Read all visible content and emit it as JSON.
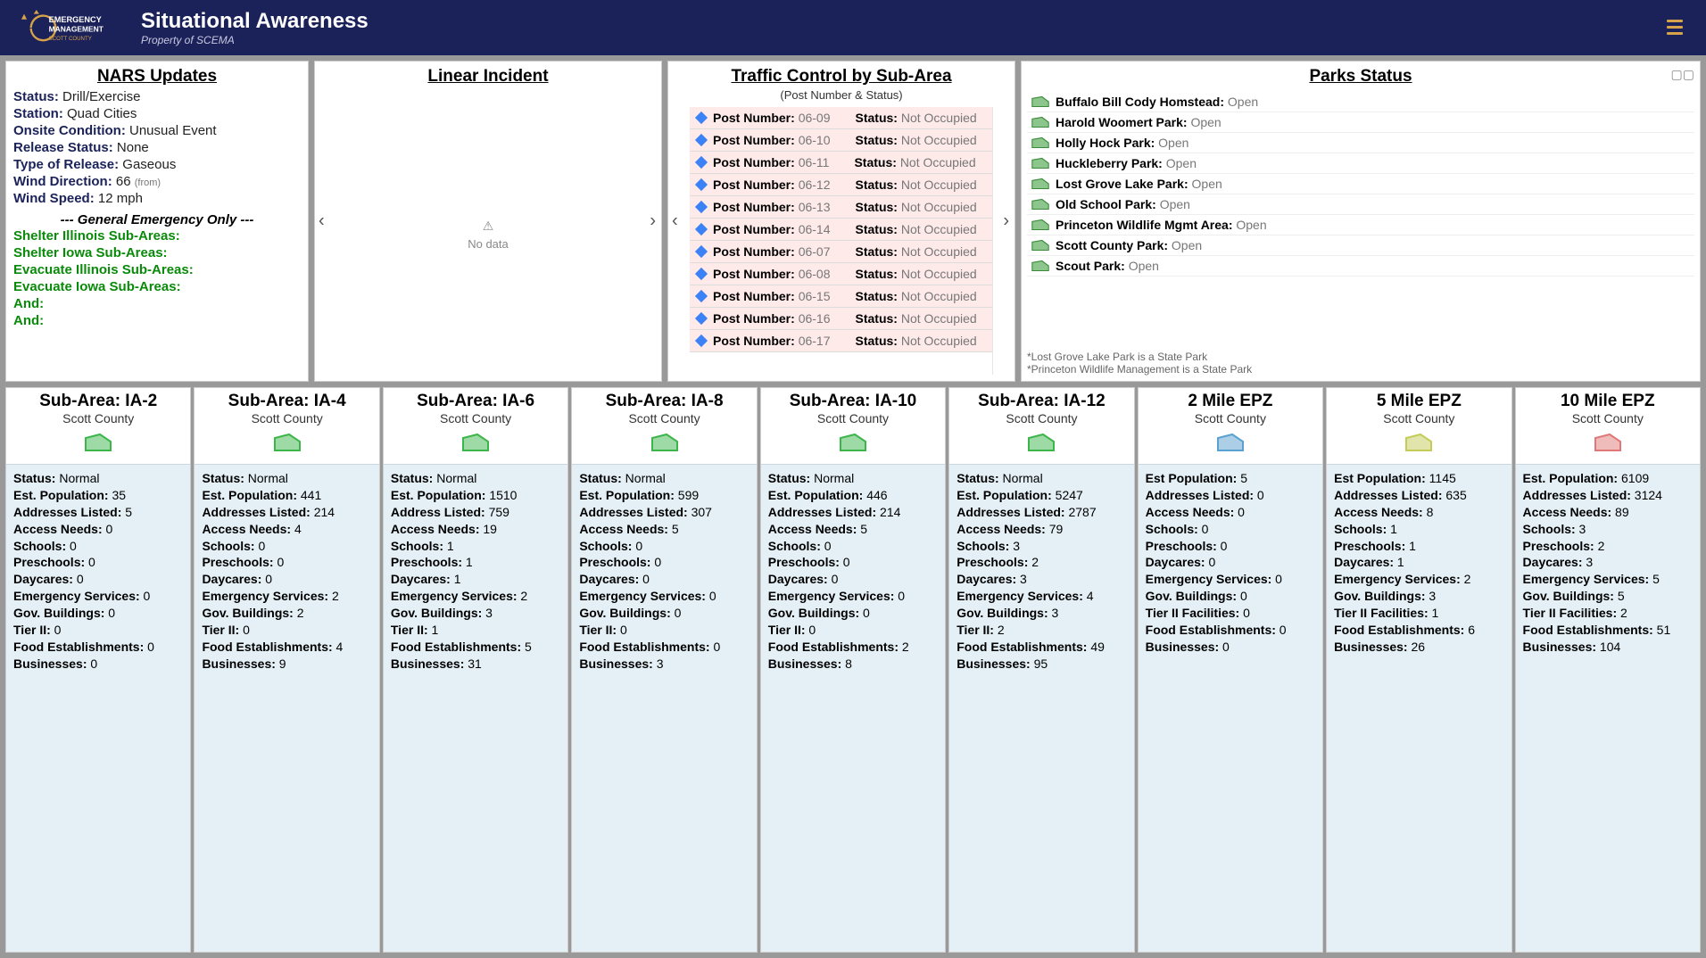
{
  "header": {
    "title": "Situational Awareness",
    "subtitle": "Property of SCEMA"
  },
  "nars": {
    "heading": "NARS Updates",
    "status_lbl": "Status:",
    "status": "Drill/Exercise",
    "station_lbl": "Station:",
    "station": "Quad Cities",
    "onsite_lbl": "Onsite Condition:",
    "onsite": "Unusual Event",
    "release_lbl": "Release Status:",
    "release": "None",
    "type_lbl": "Type of Release:",
    "type": "Gaseous",
    "wdir_lbl": "Wind Direction:",
    "wdir": "66",
    "wdir_from": "(from)",
    "wspd_lbl": "Wind Speed:",
    "wspd": "12 mph",
    "geo": "--- General Emergency Only ---",
    "lines": [
      "Shelter Illinois Sub-Areas:",
      "Shelter Iowa Sub-Areas:",
      "Evacuate Illinois Sub-Areas:",
      "Evacuate Iowa Sub-Areas:",
      "And:",
      "And:"
    ]
  },
  "linear": {
    "heading": "Linear Incident",
    "nodata": "No data"
  },
  "traffic": {
    "heading": "Traffic Control by Sub-Area",
    "sub": "(Post Number & Status)",
    "post_lbl": "Post Number:",
    "status_lbl": "Status:",
    "posts": [
      {
        "num": "06-09",
        "status": "Not Occupied"
      },
      {
        "num": "06-10",
        "status": "Not Occupied"
      },
      {
        "num": "06-11",
        "status": "Not Occupied"
      },
      {
        "num": "06-12",
        "status": "Not Occupied"
      },
      {
        "num": "06-13",
        "status": "Not Occupied"
      },
      {
        "num": "06-14",
        "status": "Not Occupied"
      },
      {
        "num": "06-07",
        "status": "Not Occupied"
      },
      {
        "num": "06-08",
        "status": "Not Occupied"
      },
      {
        "num": "06-15",
        "status": "Not Occupied"
      },
      {
        "num": "06-16",
        "status": "Not Occupied"
      },
      {
        "num": "06-17",
        "status": "Not Occupied"
      }
    ]
  },
  "parks": {
    "heading": "Parks Status",
    "items": [
      {
        "name": "Buffalo Bill Cody Homstead:",
        "status": "Open"
      },
      {
        "name": "Harold Woomert Park:",
        "status": "Open"
      },
      {
        "name": "Holly Hock Park:",
        "status": "Open"
      },
      {
        "name": "Huckleberry Park:",
        "status": "Open"
      },
      {
        "name": "Lost Grove Lake Park:",
        "status": "Open"
      },
      {
        "name": "Old School Park:",
        "status": "Open"
      },
      {
        "name": "Princeton Wildlife Mgmt Area:",
        "status": "Open"
      },
      {
        "name": "Scott County Park:",
        "status": "Open"
      },
      {
        "name": "Scout Park:",
        "status": "Open"
      }
    ],
    "footnote1": "*Lost Grove Lake Park is a State Park",
    "footnote2": "*Princeton Wildlife Management is a State Park"
  },
  "cards": [
    {
      "title": "Sub-Area: IA-2",
      "county": "Scott County",
      "color": "#3cb54b",
      "fields": [
        [
          "Status:",
          "Normal"
        ],
        [
          "Est. Population:",
          "35"
        ],
        [
          "Addresses Listed:",
          "5"
        ],
        [
          "Access Needs:",
          "0"
        ],
        [
          "Schools:",
          "0"
        ],
        [
          "Preschools:",
          "0"
        ],
        [
          "Daycares:",
          "0"
        ],
        [
          "Emergency Services:",
          "0"
        ],
        [
          "Gov. Buildings:",
          "0"
        ],
        [
          "Tier II:",
          "0"
        ],
        [
          "Food Establishments:",
          "0"
        ],
        [
          "Businesses:",
          "0"
        ]
      ]
    },
    {
      "title": "Sub-Area: IA-4",
      "county": "Scott County",
      "color": "#3cb54b",
      "fields": [
        [
          "Status:",
          "Normal"
        ],
        [
          "Est. Population:",
          "441"
        ],
        [
          "Addresses Listed:",
          "214"
        ],
        [
          "Access Needs:",
          "4"
        ],
        [
          "Schools:",
          "0"
        ],
        [
          "Preschools:",
          "0"
        ],
        [
          "Daycares:",
          "0"
        ],
        [
          "Emergency Services:",
          "2"
        ],
        [
          "Gov. Buildings:",
          "2"
        ],
        [
          "Tier II:",
          "0"
        ],
        [
          "Food Establishments:",
          "4"
        ],
        [
          "Businesses:",
          "9"
        ]
      ]
    },
    {
      "title": "Sub-Area: IA-6",
      "county": "Scott County",
      "color": "#3cb54b",
      "fields": [
        [
          "Status:",
          "Normal"
        ],
        [
          "Est. Population:",
          "1510"
        ],
        [
          "Address Listed:",
          "759"
        ],
        [
          "Access Needs:",
          "19"
        ],
        [
          "Schools:",
          "1"
        ],
        [
          "Preschools:",
          "1"
        ],
        [
          "Daycares:",
          "1"
        ],
        [
          "Emergency Services:",
          "2"
        ],
        [
          "Gov. Buildings:",
          "3"
        ],
        [
          "Tier II:",
          "1"
        ],
        [
          "Food Establishments:",
          "5"
        ],
        [
          "Businesses:",
          "31"
        ]
      ]
    },
    {
      "title": "Sub-Area: IA-8",
      "county": "Scott County",
      "color": "#3cb54b",
      "fields": [
        [
          "Status:",
          "Normal"
        ],
        [
          "Est. Population:",
          "599"
        ],
        [
          "Addresses Listed:",
          "307"
        ],
        [
          "Access Needs:",
          "5"
        ],
        [
          "Schools:",
          "0"
        ],
        [
          "Preschools:",
          "0"
        ],
        [
          "Daycares:",
          "0"
        ],
        [
          "Emergency Services:",
          "0"
        ],
        [
          "Gov. Buildings:",
          "0"
        ],
        [
          "Tier II:",
          "0"
        ],
        [
          "Food Establishments:",
          "0"
        ],
        [
          "Businesses:",
          "3"
        ]
      ]
    },
    {
      "title": "Sub-Area: IA-10",
      "county": "Scott County",
      "color": "#3cb54b",
      "fields": [
        [
          "Status:",
          "Normal"
        ],
        [
          "Est. Population:",
          "446"
        ],
        [
          "Addresses Listed:",
          "214"
        ],
        [
          "Access Needs:",
          "5"
        ],
        [
          "Schools:",
          "0"
        ],
        [
          "Preschools:",
          "0"
        ],
        [
          "Daycares:",
          "0"
        ],
        [
          "Emergency Services:",
          "0"
        ],
        [
          "Gov. Buildings:",
          "0"
        ],
        [
          "Tier II:",
          "0"
        ],
        [
          "Food Establishments:",
          "2"
        ],
        [
          "Businesses:",
          "8"
        ]
      ]
    },
    {
      "title": "Sub-Area: IA-12",
      "county": "Scott County",
      "color": "#3cb54b",
      "fields": [
        [
          "Status:",
          "Normal"
        ],
        [
          "Est. Population:",
          "5247"
        ],
        [
          "Addresses Listed:",
          "2787"
        ],
        [
          "Access Needs:",
          "79"
        ],
        [
          "Schools:",
          "3"
        ],
        [
          "Preschools:",
          "2"
        ],
        [
          "Daycares:",
          "3"
        ],
        [
          "Emergency Services:",
          "4"
        ],
        [
          "Gov. Buildings:",
          "3"
        ],
        [
          "Tier II:",
          "2"
        ],
        [
          "Food Establishments:",
          "49"
        ],
        [
          "Businesses:",
          "95"
        ]
      ]
    },
    {
      "title": "2 Mile EPZ",
      "county": "Scott County",
      "color": "#5aa0d0",
      "fields": [
        [
          "Est Population:",
          "5"
        ],
        [
          "Addresses Listed:",
          "0"
        ],
        [
          "Access Needs:",
          "0"
        ],
        [
          "Schools:",
          "0"
        ],
        [
          "Preschools:",
          "0"
        ],
        [
          "Daycares:",
          "0"
        ],
        [
          "Emergency Services:",
          "0"
        ],
        [
          "Gov. Buildings:",
          "0"
        ],
        [
          "Tier II Facilities:",
          "0"
        ],
        [
          "Food Establishments:",
          "0"
        ],
        [
          "Businesses:",
          "0"
        ]
      ]
    },
    {
      "title": "5 Mile EPZ",
      "county": "Scott County",
      "color": "#c4cc58",
      "fields": [
        [
          "Est Population:",
          "1145"
        ],
        [
          "Addresses Listed:",
          "635"
        ],
        [
          "Access Needs:",
          "8"
        ],
        [
          "Schools:",
          "1"
        ],
        [
          "Preschools:",
          "1"
        ],
        [
          "Daycares:",
          "1"
        ],
        [
          "Emergency Services:",
          "2"
        ],
        [
          "Gov. Buildings:",
          "3"
        ],
        [
          "Tier II Facilities:",
          "1"
        ],
        [
          "Food Establishments:",
          "6"
        ],
        [
          "Businesses:",
          "26"
        ]
      ]
    },
    {
      "title": "10 Mile EPZ",
      "county": "Scott County",
      "color": "#e07878",
      "fields": [
        [
          "Est. Population:",
          "6109"
        ],
        [
          "Addresses Listed:",
          "3124"
        ],
        [
          "Access Needs:",
          "89"
        ],
        [
          "Schools:",
          "3"
        ],
        [
          "Preschools:",
          "2"
        ],
        [
          "Daycares:",
          "3"
        ],
        [
          "Emergency Services:",
          "5"
        ],
        [
          "Gov. Buildings:",
          "5"
        ],
        [
          "Tier II Facilities:",
          "2"
        ],
        [
          "Food Establishments:",
          "51"
        ],
        [
          "Businesses:",
          "104"
        ]
      ]
    }
  ]
}
